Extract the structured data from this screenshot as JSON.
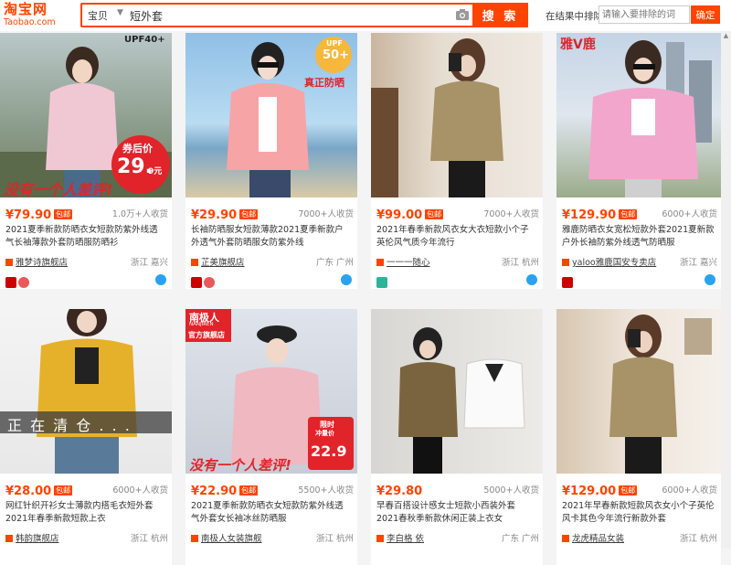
{
  "logo": {
    "main": "淘宝网",
    "sub": "Taobao.com"
  },
  "search": {
    "scope": "宝贝",
    "query": "短外套",
    "button": "搜 索"
  },
  "exclude": {
    "label": "在结果中排除",
    "placeholder": "请输入要排除的词",
    "button": "确定"
  },
  "products": [
    {
      "price": "¥79.90",
      "baoyou": "包邮",
      "sales": "1.0万+人收货",
      "title": "2021夏季新款防晒衣女短款防紫外线透气长袖薄款外套防晒服防晒衫",
      "shop": "雅梦诗旗舰店",
      "location": "浙江 嘉兴",
      "img_texts": {
        "tag": "UPF40+",
        "coupon_label": "券后价",
        "coupon_price": "29.",
        "coupon_suffix": "9元",
        "slogan": "没有一个人差评!"
      }
    },
    {
      "price": "¥29.90",
      "baoyou": "包邮",
      "sales": "7000+人收货",
      "title": "长袖防晒服女短款薄款2021夏季新款户外透气外套防晒服女防紫外线",
      "shop": "芷美旗舰店",
      "location": "广东 广州",
      "img_texts": {
        "upf_top": "UPF",
        "upf_num": "50+",
        "sub": "真正防晒"
      }
    },
    {
      "price": "¥99.00",
      "baoyou": "包邮",
      "sales": "7000+人收货",
      "title": "2021年春季新款风衣女大衣短款小个子英伦风气质今年流行",
      "shop": "一一一随心",
      "location": "浙江 杭州",
      "img_texts": {}
    },
    {
      "price": "¥129.90",
      "baoyou": "包邮",
      "sales": "6000+人收货",
      "title": "雅鹿防晒衣女宽松短款外套2021夏新款户外长袖防紫外线透气防晒服",
      "shop": "yaloo雅鹿国安专卖店",
      "location": "浙江 嘉兴",
      "img_texts": {
        "brand": "雅V鹿"
      }
    },
    {
      "price": "¥28.00",
      "baoyou": "包邮",
      "sales": "6000+人收货",
      "title": "网红针织开衫女士薄款内搭毛衣短外套2021年春季新款短款上衣",
      "shop": "韩韵旗舰店",
      "location": "浙江 杭州",
      "img_texts": {
        "banner": "正 在 清 仓 . . ."
      }
    },
    {
      "price": "¥22.90",
      "baoyou": "包邮",
      "sales": "5500+人收货",
      "title": "2021夏季新款防晒衣女短款防紫外线透气外套女长袖冰丝防晒服",
      "shop": "南极人女装旗舰",
      "location": "浙江 杭州",
      "img_texts": {
        "brand": "南极人",
        "brand_en": "NANJIREN",
        "store": "官方旗舰店",
        "limit": "限时",
        "limit2": "冲量价",
        "price": "22.9",
        "slogan": "没有一个人差评!"
      }
    },
    {
      "price": "¥29.80",
      "baoyou": "",
      "sales": "5000+人收货",
      "title": "早春百搭设计感女士短款小西装外套2021春秋季新款休闲正装上衣女",
      "shop": "李白格 依",
      "location": "广东 广州",
      "img_texts": {}
    },
    {
      "price": "¥129.00",
      "baoyou": "包邮",
      "sales": "6000+人收货",
      "title": "2021年早春新款短款风衣女小个子英伦风卡其色今年流行新款外套",
      "shop": "龙虎精品女装",
      "location": "浙江 杭州",
      "img_texts": {}
    }
  ]
}
